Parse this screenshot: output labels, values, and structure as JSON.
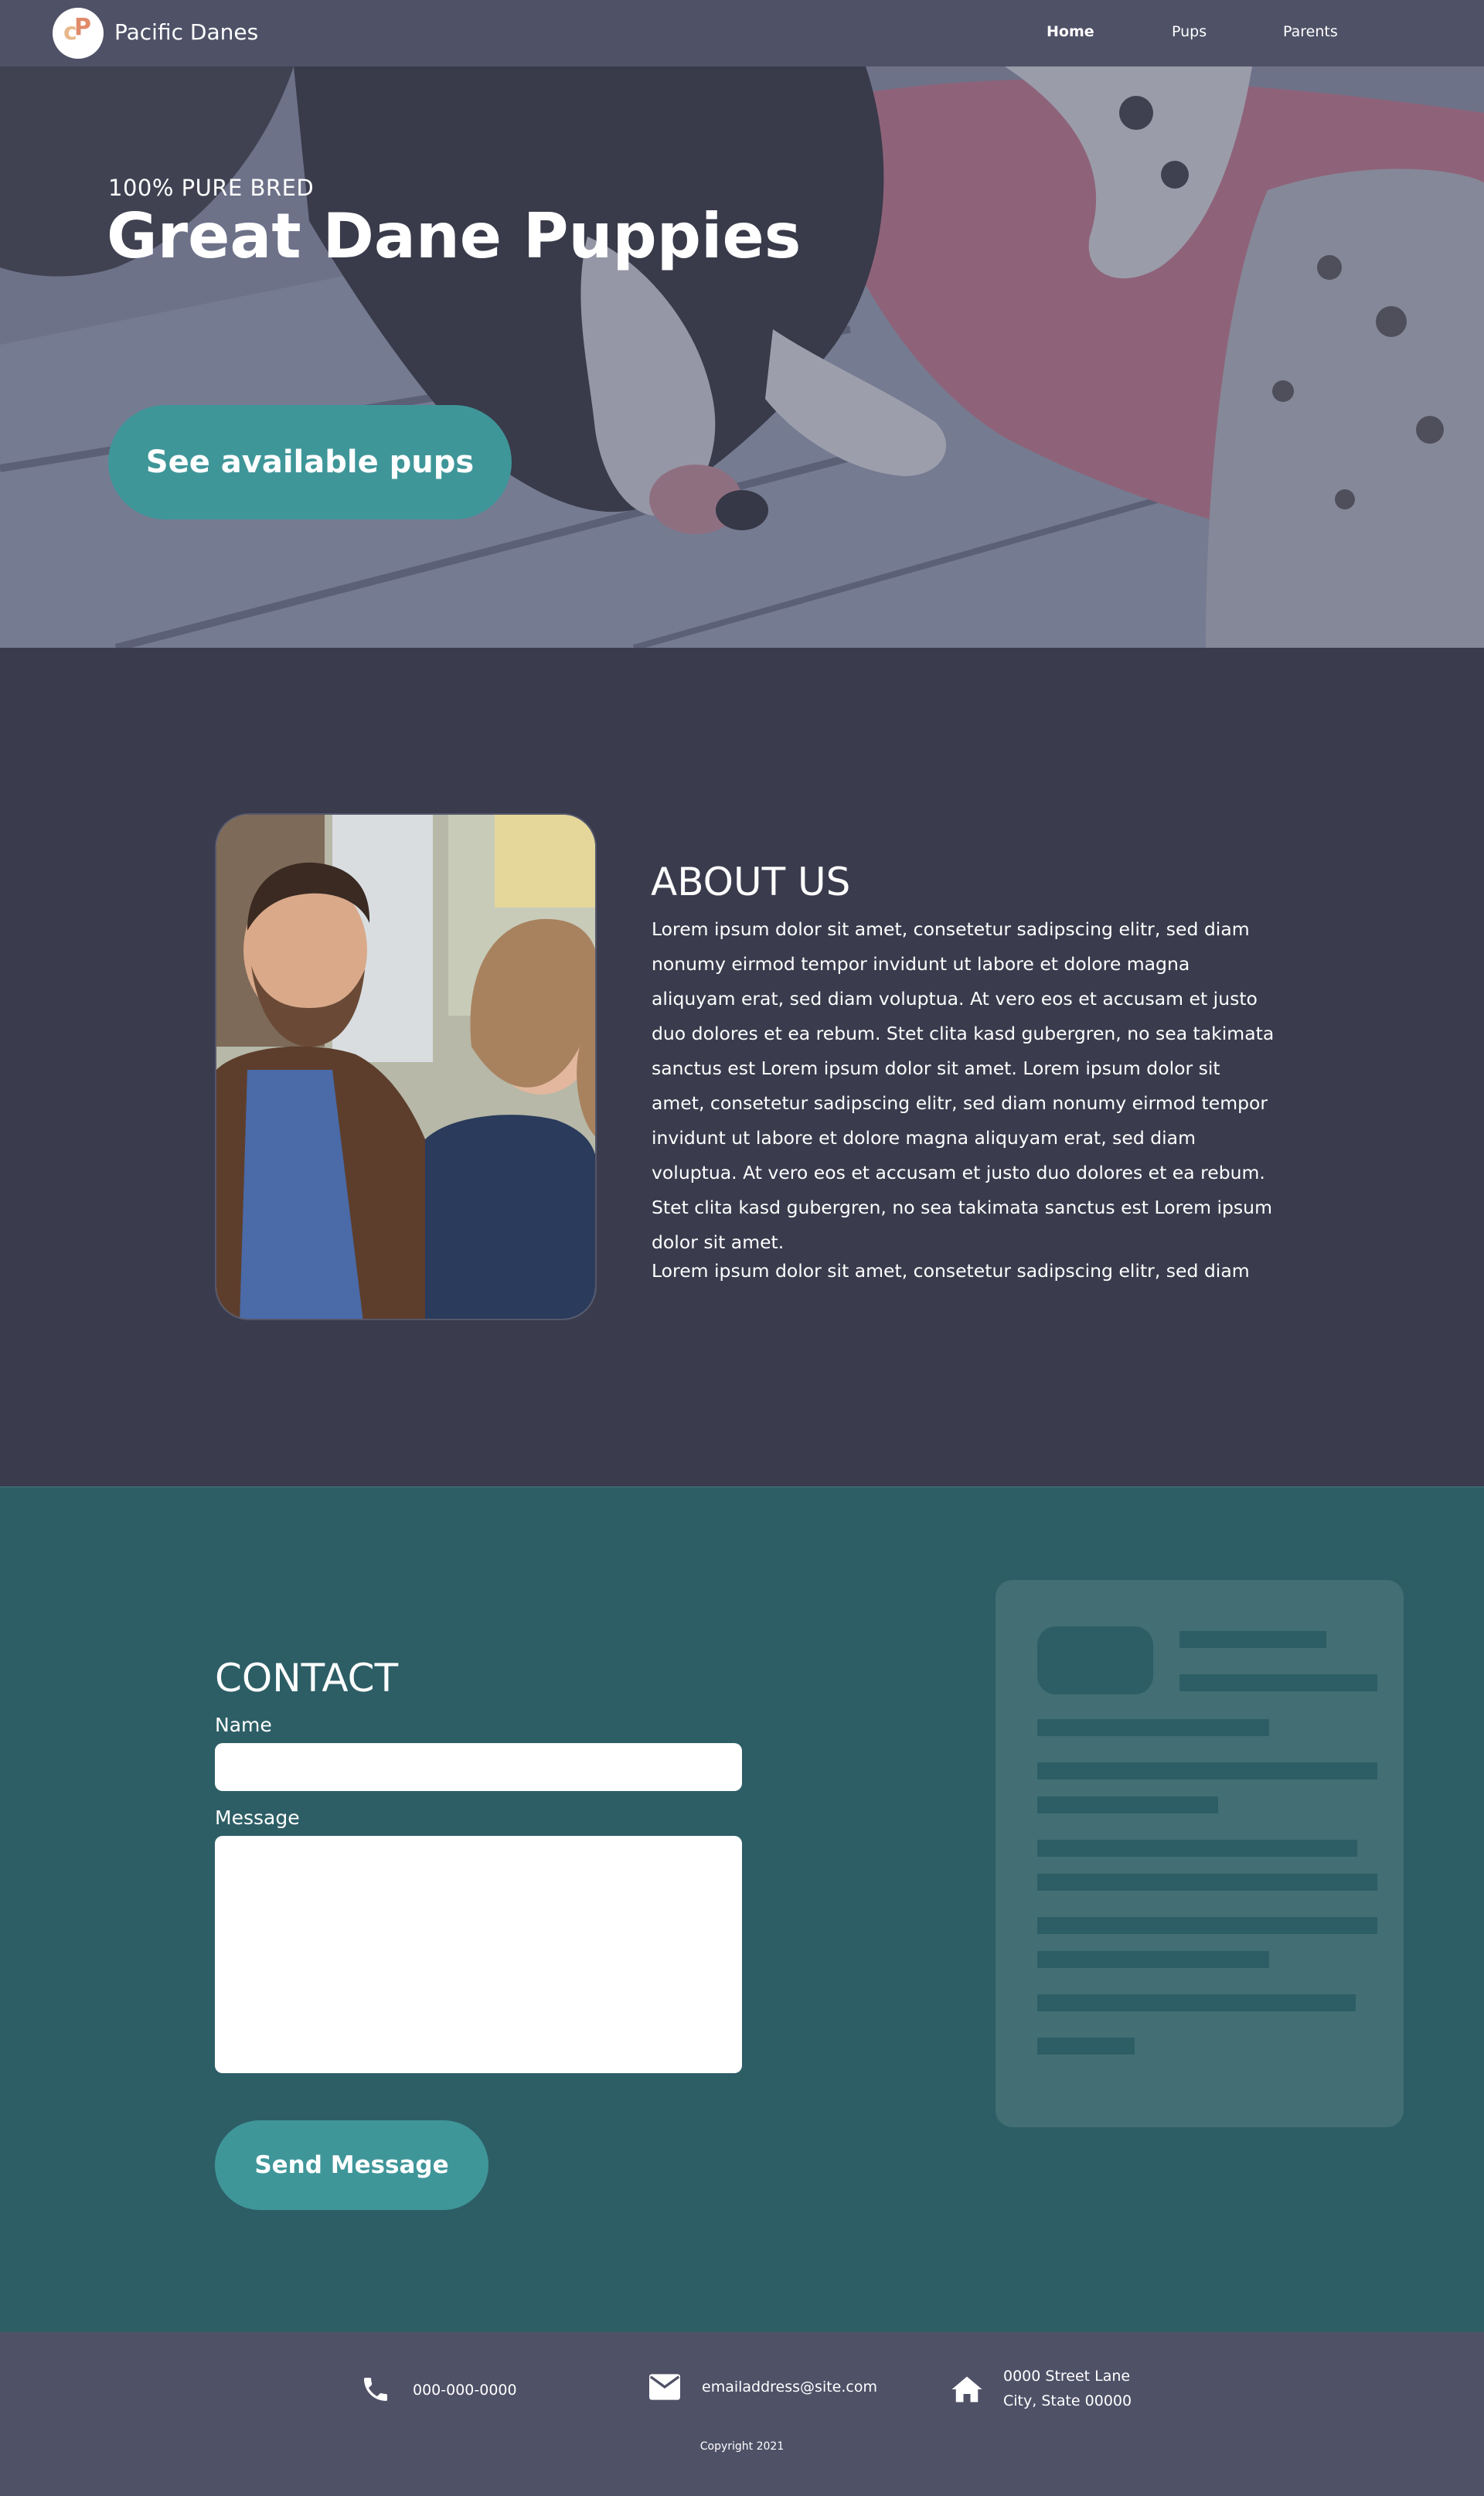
{
  "nav": {
    "brand": "Pacific Danes",
    "links": [
      {
        "label": "Home",
        "active": true
      },
      {
        "label": "Pups",
        "active": false
      },
      {
        "label": "Parents",
        "active": false
      }
    ]
  },
  "hero": {
    "kicker": "100% PURE BRED",
    "title": "Great Dane Puppies",
    "cta": "See available pups"
  },
  "about": {
    "title": "ABOUT US",
    "paragraph1": "Lorem ipsum dolor sit amet, consetetur sadipscing elitr, sed diam nonumy eirmod tempor invidunt ut labore et dolore magna aliquyam erat, sed diam voluptua. At vero eos et accusam et justo duo dolores et ea rebum. Stet clita kasd gubergren, no sea takimata sanctus est Lorem ipsum dolor sit amet. Lorem ipsum dolor sit amet, consetetur sadipscing elitr, sed diam nonumy eirmod tempor invidunt ut labore et dolore magna aliquyam erat, sed diam voluptua. At vero eos et accusam et justo duo dolores et ea rebum. Stet clita kasd gubergren, no sea takimata sanctus est Lorem ipsum dolor sit amet.",
    "paragraph2": "Lorem ipsum dolor sit amet, consetetur sadipscing elitr, sed diam"
  },
  "contact": {
    "title": "CONTACT",
    "name_label": "Name",
    "name_value": "",
    "message_label": "Message",
    "message_value": "",
    "send_label": "Send Message"
  },
  "footer": {
    "phone": "000-000-0000",
    "email": "emailaddress@site.com",
    "address_line1": "0000 Street Lane",
    "address_line2": "City, State 00000",
    "copyright": "Copyright 2021"
  },
  "colors": {
    "nav_bg": "#4f5167",
    "about_bg": "#3a3b4d",
    "contact_bg": "#2d5e66",
    "accent": "#3f9699"
  },
  "icons": {
    "phone": "phone-icon",
    "email": "envelope-icon",
    "address": "home-icon"
  }
}
